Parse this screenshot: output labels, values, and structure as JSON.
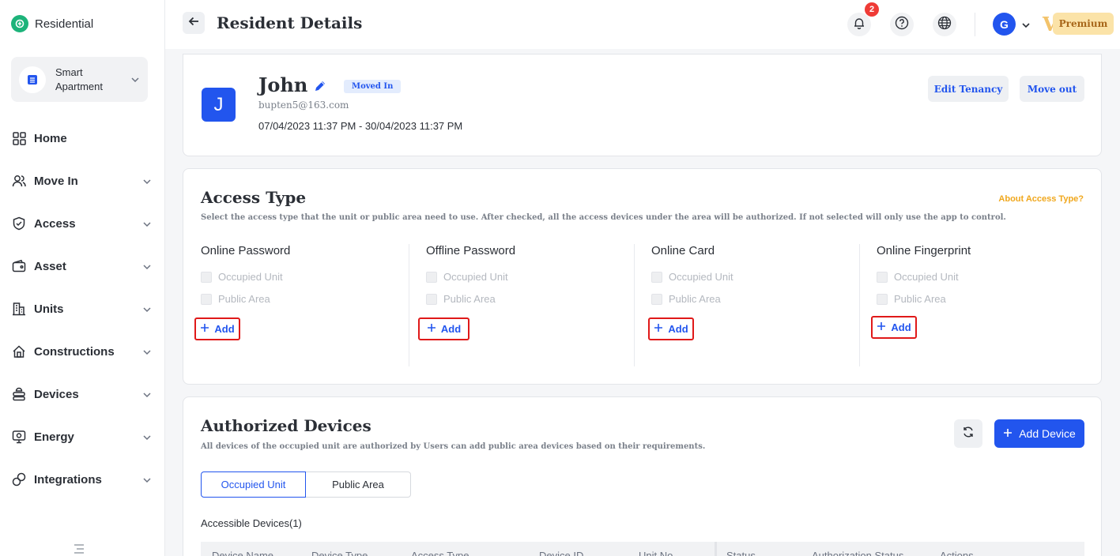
{
  "app": {
    "name": "Residential",
    "brand_color": "#1db37a",
    "accent_color": "#2255ee"
  },
  "sidebar": {
    "project_name": "Smart Apartment",
    "items": [
      {
        "label": "Home",
        "icon": "grid-icon",
        "has_chevron": false
      },
      {
        "label": "Move In",
        "icon": "users-icon",
        "has_chevron": true
      },
      {
        "label": "Access",
        "icon": "shield-check-icon",
        "has_chevron": true
      },
      {
        "label": "Asset",
        "icon": "wallet-icon",
        "has_chevron": true
      },
      {
        "label": "Units",
        "icon": "building-icon",
        "has_chevron": true
      },
      {
        "label": "Constructions",
        "icon": "construction-icon",
        "has_chevron": true
      },
      {
        "label": "Devices",
        "icon": "devices-icon",
        "has_chevron": true
      },
      {
        "label": "Energy",
        "icon": "energy-icon",
        "has_chevron": true
      },
      {
        "label": "Integrations",
        "icon": "integrations-icon",
        "has_chevron": true
      }
    ]
  },
  "header": {
    "title": "Resident Details",
    "notification_count": "2",
    "avatar_initial": "G",
    "premium_mark": "V",
    "premium_label": "Premium"
  },
  "profile": {
    "avatar_initial": "J",
    "name": "John",
    "status": "Moved In",
    "email": "bupten5@163.com",
    "period": "07/04/2023 11:37 PM - 30/04/2023 11:37 PM",
    "edit_tenancy_label": "Edit Tenancy",
    "move_out_label": "Move out"
  },
  "access_type": {
    "title": "Access Type",
    "description": "Select the access type that the unit or public area need to use. After checked, all the access devices under the area will be authorized. If not selected will only use the app to control.",
    "about_link": "About Access Type?",
    "columns": [
      {
        "title": "Online Password",
        "option1": "Occupied Unit",
        "option2": "Public Area",
        "add_label": "Add"
      },
      {
        "title": "Offline Password",
        "option1": "Occupied Unit",
        "option2": "Public Area",
        "add_label": "Add"
      },
      {
        "title": "Online Card",
        "option1": "Occupied Unit",
        "option2": "Public Area",
        "add_label": "Add"
      },
      {
        "title": "Online Fingerprint",
        "option1": "Occupied Unit",
        "option2": "Public Area",
        "add_label": "Add"
      }
    ]
  },
  "authorized_devices": {
    "title": "Authorized Devices",
    "description": "All devices of the occupied unit are authorized by  Users can add public area devices based on their requirements.",
    "add_device_label": "Add Device",
    "tabs": [
      "Occupied Unit",
      "Public Area"
    ],
    "accessible_title": "Accessible Devices(1)",
    "columns": [
      "Device Name",
      "Device Type",
      "Access Type",
      "Device ID",
      "Unit No.",
      "Status",
      "Authorization Status",
      "Actions"
    ]
  }
}
